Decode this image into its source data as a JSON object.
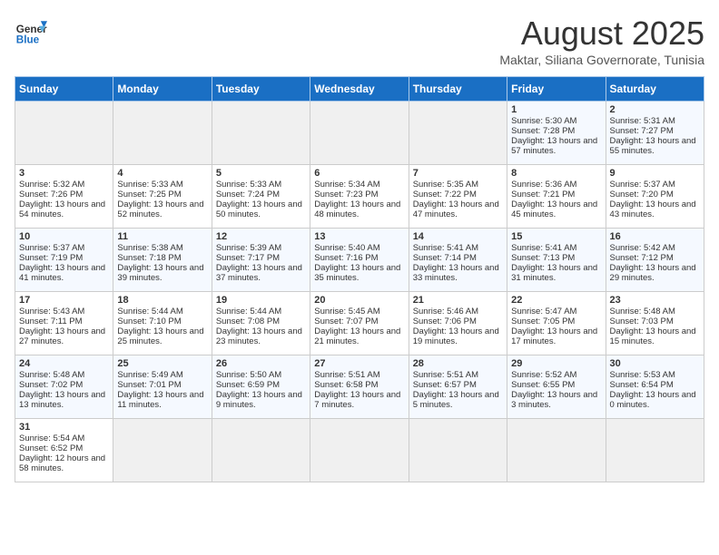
{
  "header": {
    "logo_general": "General",
    "logo_blue": "Blue",
    "title": "August 2025",
    "subtitle": "Maktar, Siliana Governorate, Tunisia"
  },
  "days_of_week": [
    "Sunday",
    "Monday",
    "Tuesday",
    "Wednesday",
    "Thursday",
    "Friday",
    "Saturday"
  ],
  "weeks": [
    [
      {
        "num": "",
        "data": ""
      },
      {
        "num": "",
        "data": ""
      },
      {
        "num": "",
        "data": ""
      },
      {
        "num": "",
        "data": ""
      },
      {
        "num": "",
        "data": ""
      },
      {
        "num": "1",
        "data": "Sunrise: 5:30 AM\nSunset: 7:28 PM\nDaylight: 13 hours and 57 minutes."
      },
      {
        "num": "2",
        "data": "Sunrise: 5:31 AM\nSunset: 7:27 PM\nDaylight: 13 hours and 55 minutes."
      }
    ],
    [
      {
        "num": "3",
        "data": "Sunrise: 5:32 AM\nSunset: 7:26 PM\nDaylight: 13 hours and 54 minutes."
      },
      {
        "num": "4",
        "data": "Sunrise: 5:33 AM\nSunset: 7:25 PM\nDaylight: 13 hours and 52 minutes."
      },
      {
        "num": "5",
        "data": "Sunrise: 5:33 AM\nSunset: 7:24 PM\nDaylight: 13 hours and 50 minutes."
      },
      {
        "num": "6",
        "data": "Sunrise: 5:34 AM\nSunset: 7:23 PM\nDaylight: 13 hours and 48 minutes."
      },
      {
        "num": "7",
        "data": "Sunrise: 5:35 AM\nSunset: 7:22 PM\nDaylight: 13 hours and 47 minutes."
      },
      {
        "num": "8",
        "data": "Sunrise: 5:36 AM\nSunset: 7:21 PM\nDaylight: 13 hours and 45 minutes."
      },
      {
        "num": "9",
        "data": "Sunrise: 5:37 AM\nSunset: 7:20 PM\nDaylight: 13 hours and 43 minutes."
      }
    ],
    [
      {
        "num": "10",
        "data": "Sunrise: 5:37 AM\nSunset: 7:19 PM\nDaylight: 13 hours and 41 minutes."
      },
      {
        "num": "11",
        "data": "Sunrise: 5:38 AM\nSunset: 7:18 PM\nDaylight: 13 hours and 39 minutes."
      },
      {
        "num": "12",
        "data": "Sunrise: 5:39 AM\nSunset: 7:17 PM\nDaylight: 13 hours and 37 minutes."
      },
      {
        "num": "13",
        "data": "Sunrise: 5:40 AM\nSunset: 7:16 PM\nDaylight: 13 hours and 35 minutes."
      },
      {
        "num": "14",
        "data": "Sunrise: 5:41 AM\nSunset: 7:14 PM\nDaylight: 13 hours and 33 minutes."
      },
      {
        "num": "15",
        "data": "Sunrise: 5:41 AM\nSunset: 7:13 PM\nDaylight: 13 hours and 31 minutes."
      },
      {
        "num": "16",
        "data": "Sunrise: 5:42 AM\nSunset: 7:12 PM\nDaylight: 13 hours and 29 minutes."
      }
    ],
    [
      {
        "num": "17",
        "data": "Sunrise: 5:43 AM\nSunset: 7:11 PM\nDaylight: 13 hours and 27 minutes."
      },
      {
        "num": "18",
        "data": "Sunrise: 5:44 AM\nSunset: 7:10 PM\nDaylight: 13 hours and 25 minutes."
      },
      {
        "num": "19",
        "data": "Sunrise: 5:44 AM\nSunset: 7:08 PM\nDaylight: 13 hours and 23 minutes."
      },
      {
        "num": "20",
        "data": "Sunrise: 5:45 AM\nSunset: 7:07 PM\nDaylight: 13 hours and 21 minutes."
      },
      {
        "num": "21",
        "data": "Sunrise: 5:46 AM\nSunset: 7:06 PM\nDaylight: 13 hours and 19 minutes."
      },
      {
        "num": "22",
        "data": "Sunrise: 5:47 AM\nSunset: 7:05 PM\nDaylight: 13 hours and 17 minutes."
      },
      {
        "num": "23",
        "data": "Sunrise: 5:48 AM\nSunset: 7:03 PM\nDaylight: 13 hours and 15 minutes."
      }
    ],
    [
      {
        "num": "24",
        "data": "Sunrise: 5:48 AM\nSunset: 7:02 PM\nDaylight: 13 hours and 13 minutes."
      },
      {
        "num": "25",
        "data": "Sunrise: 5:49 AM\nSunset: 7:01 PM\nDaylight: 13 hours and 11 minutes."
      },
      {
        "num": "26",
        "data": "Sunrise: 5:50 AM\nSunset: 6:59 PM\nDaylight: 13 hours and 9 minutes."
      },
      {
        "num": "27",
        "data": "Sunrise: 5:51 AM\nSunset: 6:58 PM\nDaylight: 13 hours and 7 minutes."
      },
      {
        "num": "28",
        "data": "Sunrise: 5:51 AM\nSunset: 6:57 PM\nDaylight: 13 hours and 5 minutes."
      },
      {
        "num": "29",
        "data": "Sunrise: 5:52 AM\nSunset: 6:55 PM\nDaylight: 13 hours and 3 minutes."
      },
      {
        "num": "30",
        "data": "Sunrise: 5:53 AM\nSunset: 6:54 PM\nDaylight: 13 hours and 0 minutes."
      }
    ],
    [
      {
        "num": "31",
        "data": "Sunrise: 5:54 AM\nSunset: 6:52 PM\nDaylight: 12 hours and 58 minutes."
      },
      {
        "num": "",
        "data": ""
      },
      {
        "num": "",
        "data": ""
      },
      {
        "num": "",
        "data": ""
      },
      {
        "num": "",
        "data": ""
      },
      {
        "num": "",
        "data": ""
      },
      {
        "num": "",
        "data": ""
      }
    ]
  ]
}
